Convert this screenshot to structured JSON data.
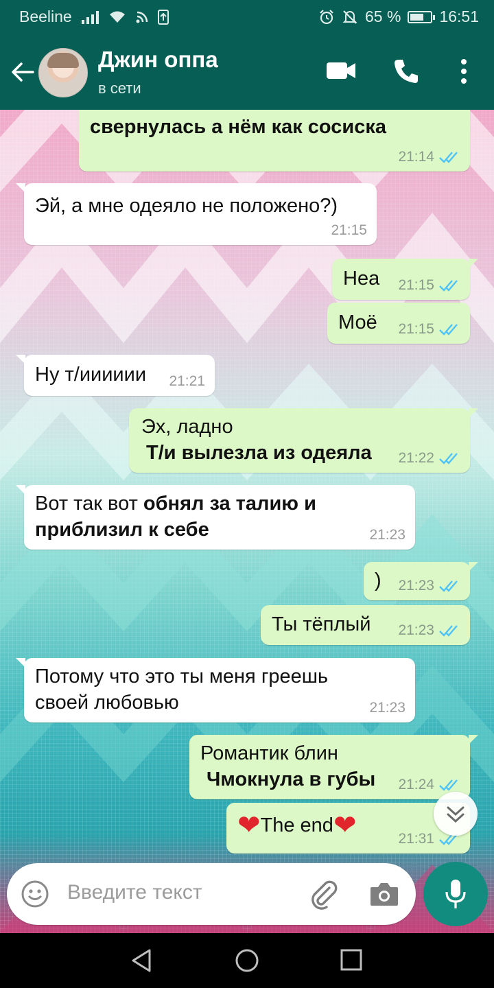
{
  "status_bar": {
    "carrier": "Beeline",
    "battery_percent": "65 %",
    "battery_level": 0.65,
    "time": "16:51",
    "icons": [
      "signal-icon",
      "wifi-icon",
      "data-icon",
      "sim-icon",
      "alarm-icon",
      "mute-icon",
      "battery-icon"
    ]
  },
  "header": {
    "contact_name": "Джин оппа",
    "contact_status": "в сети",
    "icons": [
      "back-arrow-icon",
      "video-call-icon",
      "phone-icon",
      "more-vert-icon"
    ]
  },
  "messages": [
    {
      "direction": "out",
      "lines": [
        {
          "text": "свернулась а нём как сосиска",
          "bold": true
        }
      ],
      "time": "21:14",
      "read": true
    },
    {
      "direction": "in",
      "lines": [
        {
          "text": "Эй, а мне одеяло не положено?)",
          "bold": false
        }
      ],
      "time": "21:15"
    },
    {
      "direction": "out",
      "lines": [
        {
          "text": "Неа",
          "bold": false
        }
      ],
      "time": "21:15",
      "read": true
    },
    {
      "direction": "out",
      "lines": [
        {
          "text": "Моё",
          "bold": false
        }
      ],
      "time": "21:15",
      "read": true
    },
    {
      "direction": "in",
      "lines": [
        {
          "text": "Ну т/ииииии",
          "bold": false
        }
      ],
      "time": "21:21"
    },
    {
      "direction": "out",
      "line1": "Эх, ладно",
      "line2": "Т/и вылезла из одеяла",
      "time": "21:22",
      "read": true
    },
    {
      "direction": "in",
      "part1": "Вот так вот ",
      "part2": "обнял за талию и",
      "part3": "приблизил к себе",
      "time": "21:23"
    },
    {
      "direction": "out",
      "lines": [
        {
          "text": ")",
          "bold": false
        }
      ],
      "time": "21:23",
      "read": true
    },
    {
      "direction": "out",
      "lines": [
        {
          "text": "Ты тёплый",
          "bold": false
        }
      ],
      "time": "21:23",
      "read": true
    },
    {
      "direction": "in",
      "line1": "Потому что это ты меня греешь",
      "line2": "своей любовью",
      "time": "21:23"
    },
    {
      "direction": "out",
      "line1": "Романтик блин",
      "line2": "Чмокнула в губы",
      "time": "21:24",
      "read": true
    },
    {
      "direction": "out",
      "heart": "❤",
      "text": "The end",
      "time": "21:31",
      "read": true
    }
  ],
  "input": {
    "placeholder": "Введите текст",
    "icons": [
      "emoji-icon",
      "attach-icon",
      "camera-icon",
      "mic-icon"
    ]
  },
  "navbar": {
    "icons": [
      "back-nav-icon",
      "home-nav-icon",
      "recents-nav-icon"
    ]
  },
  "colors": {
    "header": "#075E54",
    "outgoing_bubble": "#DCF8C6",
    "incoming_bubble": "#FFFFFF",
    "read_ticks": "#4FC3F7",
    "mic_button": "#128C7E"
  }
}
